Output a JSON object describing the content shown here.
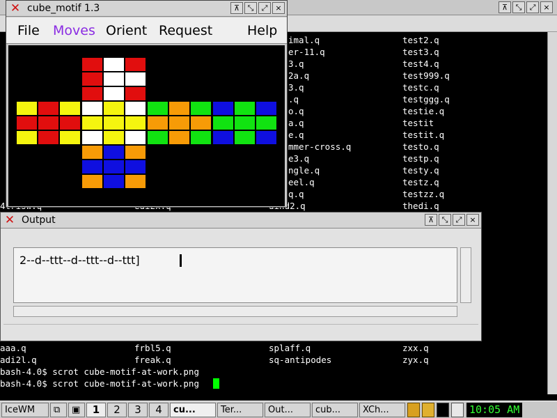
{
  "terminal": {
    "behind_rows": [
      [
        "imal.q",
        "test2.q"
      ],
      [
        "er-11.q",
        "test3.q"
      ],
      [
        "3.q",
        "test4.q"
      ],
      [
        "2a.q",
        "test999.q"
      ],
      [
        "3.q",
        "testc.q"
      ],
      [
        ".q",
        "testggg.q"
      ],
      [
        "o.q",
        "testie.q"
      ],
      [
        "a.q",
        "testit"
      ],
      [
        "e.q",
        "testit.q"
      ],
      [
        "mmer-cross.q",
        "testo.q"
      ],
      [
        "e3.q",
        "testp.q"
      ],
      [
        "ngle.q",
        "testy.q"
      ],
      [
        "eel.q",
        "testz.q"
      ],
      [
        "q.q",
        "testzz.q"
      ]
    ],
    "partial_row": [
      "4trisw.q",
      "edi2x.q",
      "dind2.q",
      "thedi.q"
    ],
    "bottom_rows": [
      [
        "aaa.q",
        "frbl5.q",
        "splaff.q",
        "zxx.q"
      ],
      [
        "adi2l.q",
        "freak.q",
        "sq-antipodes",
        "zyx.q"
      ]
    ],
    "prompt_lines": [
      "bash-4.0$ scrot cube-motif-at-work.png",
      "bash-4.0$ scrot cube-motif-at-work.png"
    ]
  },
  "cube_window": {
    "title": "cube_motif 1.3",
    "menus": [
      "File",
      "Moves",
      "Orient",
      "Request",
      "Help"
    ],
    "active_menu": "Moves",
    "faces": {
      "up": [
        [
          "red",
          "white",
          "red"
        ],
        [
          "red",
          "white",
          "white"
        ],
        [
          "red",
          "white",
          "red"
        ]
      ],
      "left": [
        [
          "yellow",
          "red",
          "yellow"
        ],
        [
          "red",
          "red",
          "red"
        ],
        [
          "yellow",
          "red",
          "yellow"
        ]
      ],
      "front": [
        [
          "white",
          "yellow",
          "white"
        ],
        [
          "yellow",
          "yellow",
          "yellow"
        ],
        [
          "white",
          "yellow",
          "white"
        ]
      ],
      "right": [
        [
          "green",
          "orange",
          "green"
        ],
        [
          "orange",
          "orange",
          "orange"
        ],
        [
          "green",
          "orange",
          "green"
        ]
      ],
      "back": [
        [
          "blue",
          "green",
          "blue"
        ],
        [
          "green",
          "green",
          "green"
        ],
        [
          "blue",
          "green",
          "blue"
        ]
      ],
      "down": [
        [
          "orange",
          "blue",
          "orange"
        ],
        [
          "blue",
          "blue",
          "blue"
        ],
        [
          "orange",
          "blue",
          "orange"
        ]
      ]
    },
    "colors": {
      "red": "#e10e0e",
      "white": "#ffffff",
      "yellow": "#f5f50f",
      "green": "#11e311",
      "orange": "#f79b07",
      "blue": "#0f0fe0"
    }
  },
  "output_window": {
    "title": "Output",
    "text": "2--d--ttt--d--ttt--d--ttt]"
  },
  "taskbar": {
    "start": "IceWM",
    "workspaces": [
      "1",
      "2",
      "3",
      "4"
    ],
    "tasks": [
      "cu...",
      "Ter...",
      "Out...",
      "cub...",
      "XCh..."
    ],
    "clock": "10:05 AM"
  }
}
